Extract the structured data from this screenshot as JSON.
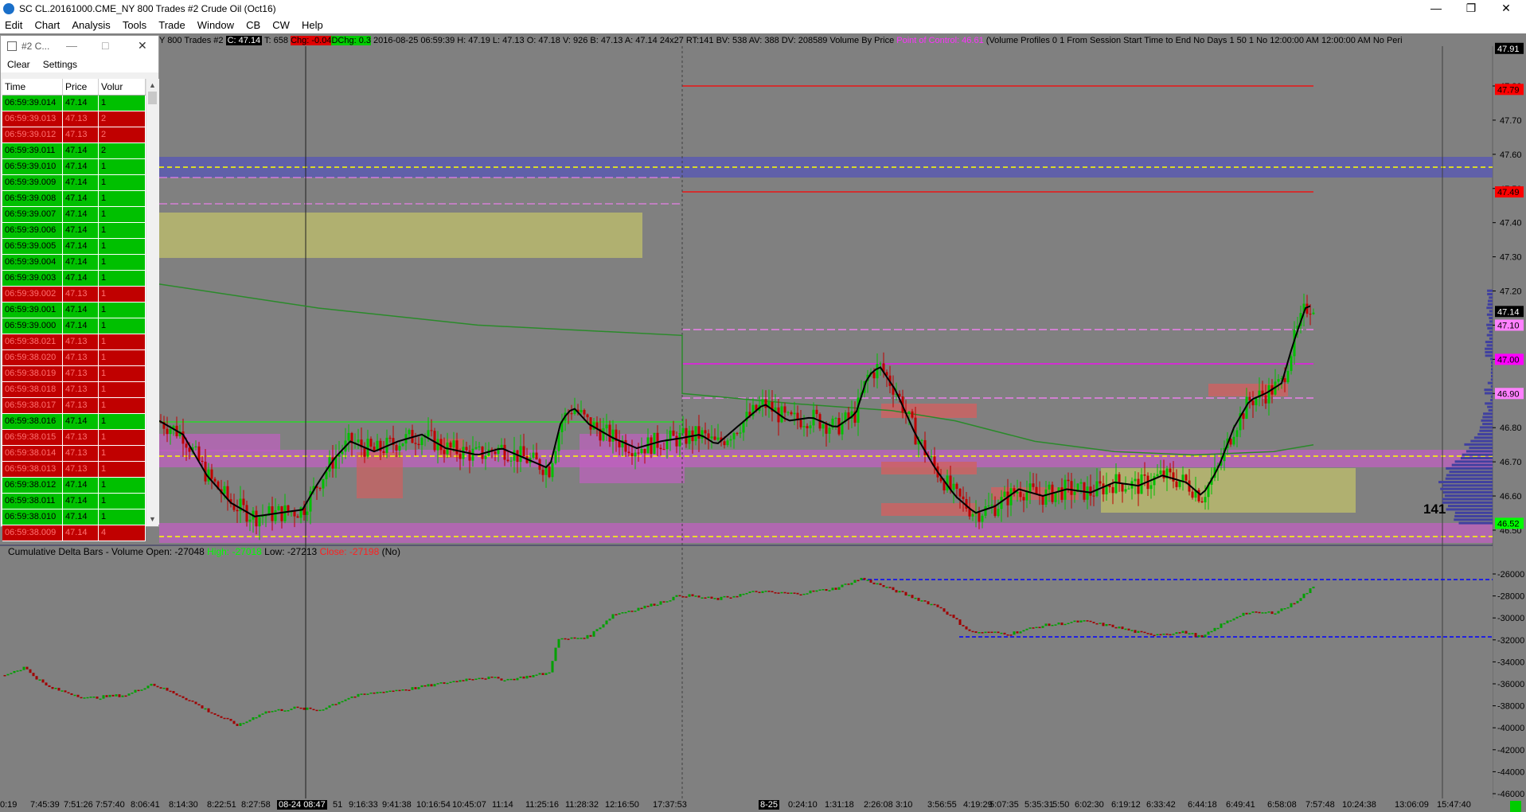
{
  "window": {
    "title": "SC CL.20161000.CME_NY  800 Trades  #2  Crude Oil (Oct16)",
    "controls": [
      "—",
      "❐",
      "✕"
    ]
  },
  "menu": [
    "Edit",
    "Chart",
    "Analysis",
    "Tools",
    "Trade",
    "Window",
    "CB",
    "CW",
    "Help"
  ],
  "chart_header": {
    "prefix": "Y  800 Trades  #2  ",
    "last": "C: 47.14",
    "trades": " T: 658 ",
    "change": "Chg: -0.04",
    "ddelta": "DChg: 0.3",
    "info": " 2016-08-25 06:59:39  H: 47.19  L: 47.13  O: 47.18  V: 926  B: 47.13  A: 47.14  24x27  RT:141  BV: 538  AV: 388  DV: 208589  Volume By Price  ",
    "poc": "Point of Control: 46.61",
    "profile": "  (Volume Profiles  0  1  From Session Start Time to End  No  Days  1  50  1   No  12:00:00 AM  12:00:00 AM  No  Peri"
  },
  "time_and_sales": {
    "title": "#2 C...",
    "buttons": [
      "—",
      "□",
      "✕"
    ],
    "toolbar": {
      "clear": "Clear",
      "settings": "Settings"
    },
    "columns": [
      "Time",
      "Price",
      "Volur"
    ],
    "rows": [
      {
        "time": "06:59:39.014",
        "price": "47.14",
        "vol": "1",
        "side": "up"
      },
      {
        "time": "06:59:39.013",
        "price": "47.13",
        "vol": "2",
        "side": "down"
      },
      {
        "time": "06:59:39.012",
        "price": "47.13",
        "vol": "2",
        "side": "down"
      },
      {
        "time": "06:59:39.011",
        "price": "47.14",
        "vol": "2",
        "side": "up"
      },
      {
        "time": "06:59:39.010",
        "price": "47.14",
        "vol": "1",
        "side": "up"
      },
      {
        "time": "06:59:39.009",
        "price": "47.14",
        "vol": "1",
        "side": "up"
      },
      {
        "time": "06:59:39.008",
        "price": "47.14",
        "vol": "1",
        "side": "up"
      },
      {
        "time": "06:59:39.007",
        "price": "47.14",
        "vol": "1",
        "side": "up"
      },
      {
        "time": "06:59:39.006",
        "price": "47.14",
        "vol": "1",
        "side": "up"
      },
      {
        "time": "06:59:39.005",
        "price": "47.14",
        "vol": "1",
        "side": "up"
      },
      {
        "time": "06:59:39.004",
        "price": "47.14",
        "vol": "1",
        "side": "up"
      },
      {
        "time": "06:59:39.003",
        "price": "47.14",
        "vol": "1",
        "side": "up"
      },
      {
        "time": "06:59:39.002",
        "price": "47.13",
        "vol": "1",
        "side": "down"
      },
      {
        "time": "06:59:39.001",
        "price": "47.14",
        "vol": "1",
        "side": "up"
      },
      {
        "time": "06:59:39.000",
        "price": "47.14",
        "vol": "1",
        "side": "up"
      },
      {
        "time": "06:59:38.021",
        "price": "47.13",
        "vol": "1",
        "side": "down"
      },
      {
        "time": "06:59:38.020",
        "price": "47.13",
        "vol": "1",
        "side": "down"
      },
      {
        "time": "06:59:38.019",
        "price": "47.13",
        "vol": "1",
        "side": "down"
      },
      {
        "time": "06:59:38.018",
        "price": "47.13",
        "vol": "1",
        "side": "down"
      },
      {
        "time": "06:59:38.017",
        "price": "47.13",
        "vol": "1",
        "side": "down"
      },
      {
        "time": "06:59:38.016",
        "price": "47.14",
        "vol": "1",
        "side": "up"
      },
      {
        "time": "06:59:38.015",
        "price": "47.13",
        "vol": "1",
        "side": "down"
      },
      {
        "time": "06:59:38.014",
        "price": "47.13",
        "vol": "1",
        "side": "down"
      },
      {
        "time": "06:59:38.013",
        "price": "47.13",
        "vol": "1",
        "side": "down"
      },
      {
        "time": "06:59:38.012",
        "price": "47.14",
        "vol": "1",
        "side": "up"
      },
      {
        "time": "06:59:38.011",
        "price": "47.14",
        "vol": "1",
        "side": "up"
      },
      {
        "time": "06:59:38.010",
        "price": "47.14",
        "vol": "1",
        "side": "up"
      },
      {
        "time": "06:59:38.009",
        "price": "47.14",
        "vol": "4",
        "side": "down"
      }
    ]
  },
  "price_axis": {
    "ticks": [
      "47.80",
      "47.70",
      "47.60",
      "47.50",
      "47.40",
      "47.30",
      "47.20",
      "47.10",
      "47.00",
      "46.90",
      "46.80",
      "46.70",
      "46.60",
      "46.50"
    ],
    "tick_values": [
      47.8,
      47.7,
      47.6,
      47.5,
      47.4,
      47.3,
      47.2,
      47.1,
      47.0,
      46.9,
      46.8,
      46.7,
      46.6,
      46.5
    ],
    "labels": [
      {
        "text": "47.91",
        "value": 47.91,
        "bg": "#000000",
        "fg": "#ffffff"
      },
      {
        "text": "47.79",
        "value": 47.79,
        "bg": "#ff0000",
        "fg": "#000000"
      },
      {
        "text": "47.49",
        "value": 47.49,
        "bg": "#ff0000",
        "fg": "#000000"
      },
      {
        "text": "47.14",
        "value": 47.14,
        "bg": "#000000",
        "fg": "#ffffff"
      },
      {
        "text": "47.10",
        "value": 47.1,
        "bg": "#ff80ff",
        "fg": "#000000"
      },
      {
        "text": "47.00",
        "value": 47.0,
        "bg": "#ff00ff",
        "fg": "#000000"
      },
      {
        "text": "46.90",
        "value": 46.9,
        "bg": "#ff80ff",
        "fg": "#000000"
      },
      {
        "text": "46.52",
        "value": 46.52,
        "bg": "#00ff00",
        "fg": "#000000"
      }
    ]
  },
  "delta_panel": {
    "label": "Cumulative Delta Bars - Volume  Open: -27048  ",
    "high": "High: -27018",
    "low": "  Low: -27213  ",
    "close": "Close: -27198",
    "suffix": "  (No)",
    "ticks": [
      "-26000",
      "-28000",
      "-30000",
      "-32000",
      "-34000",
      "-36000",
      "-38000",
      "-40000",
      "-42000",
      "-44000",
      "-46000"
    ],
    "tick_values": [
      -26000,
      -28000,
      -30000,
      -32000,
      -34000,
      -36000,
      -38000,
      -40000,
      -42000,
      -44000,
      -46000
    ]
  },
  "x_axis": [
    {
      "text": "0:19"
    },
    {
      "text": "7:45:39"
    },
    {
      "text": "7:51:26"
    },
    {
      "text": "7:57:40"
    },
    {
      "text": "8:06:41"
    },
    {
      "text": "8:14:30"
    },
    {
      "text": "8:22:51"
    },
    {
      "text": "8:27:58"
    },
    {
      "text": "08-24  08:47",
      "hl": true
    },
    {
      "text": "51"
    },
    {
      "text": "9:16:33"
    },
    {
      "text": "9:41:38"
    },
    {
      "text": "10:16:54"
    },
    {
      "text": "10:45:07"
    },
    {
      "text": "11:14"
    },
    {
      "text": "11:25:16"
    },
    {
      "text": "11:28:32"
    },
    {
      "text": "12:16:50"
    },
    {
      "text": "17:37:53"
    },
    {
      "text": "8-25",
      "hl": true
    },
    {
      "text": "0:24:10"
    },
    {
      "text": "1:31:18"
    },
    {
      "text": "2:26:08"
    },
    {
      "text": "3:10"
    },
    {
      "text": "3:56:55"
    },
    {
      "text": "4:19:29"
    },
    {
      "text": "5:07:35"
    },
    {
      "text": "5:35:31"
    },
    {
      "text": "5:50"
    },
    {
      "text": "6:02:30"
    },
    {
      "text": "6:19:12"
    },
    {
      "text": "6:33:42"
    },
    {
      "text": "6:44:18"
    },
    {
      "text": "6:49:41"
    },
    {
      "text": "6:58:08"
    },
    {
      "text": "7:57:48"
    },
    {
      "text": "10:24:38"
    },
    {
      "text": "13:06:09"
    },
    {
      "text": "15:47:40"
    }
  ],
  "rt_count": "141",
  "colors": {
    "background": "#808080",
    "up_bar": "#00c000",
    "down_bar": "#c00000",
    "poc_band": "#cc66cc",
    "value_area": "#b0b070",
    "resistance": "#ff0000",
    "vwap_line": "#2a8a2a",
    "profile": "#4040a0"
  }
}
